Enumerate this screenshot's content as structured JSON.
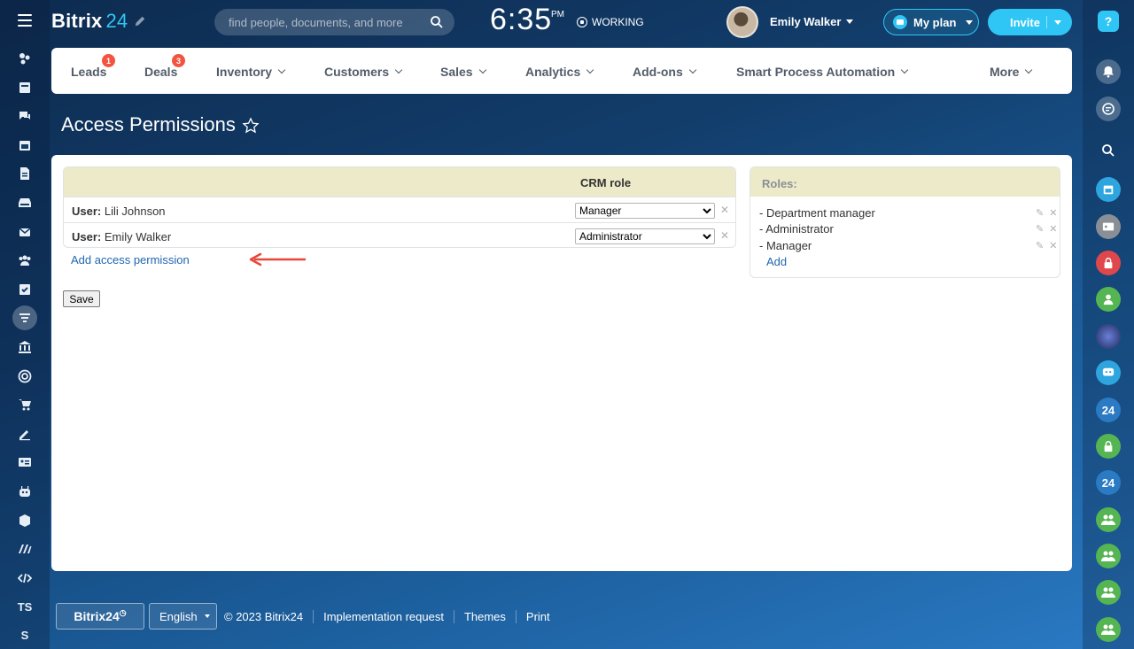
{
  "header": {
    "logo_name": "Bitrix",
    "logo_num": "24",
    "search_placeholder": "find people, documents, and more",
    "clock": "6:35",
    "clock_suffix": "PM",
    "status": "WORKING",
    "user_name": "Emily Walker",
    "myplan_label": "My plan",
    "invite_label": "Invite"
  },
  "left_sidebar": {
    "items": [
      {
        "icon": "feed-icon"
      },
      {
        "icon": "newspaper-icon"
      },
      {
        "icon": "chat-icon"
      },
      {
        "icon": "calendar-icon"
      },
      {
        "icon": "document-icon"
      },
      {
        "icon": "drive-icon"
      },
      {
        "icon": "mail-icon"
      },
      {
        "icon": "team-icon"
      },
      {
        "icon": "tasks-icon"
      },
      {
        "icon": "crm-filter-icon"
      },
      {
        "icon": "bank-icon"
      },
      {
        "icon": "target-icon"
      },
      {
        "icon": "cart-icon"
      },
      {
        "icon": "sign-icon"
      },
      {
        "icon": "contact-card-icon"
      },
      {
        "icon": "robot-icon"
      },
      {
        "icon": "box-icon"
      },
      {
        "icon": "marketing-icon"
      },
      {
        "icon": "code-icon"
      }
    ],
    "text_items": [
      "TS",
      "S"
    ]
  },
  "nav": {
    "items": [
      {
        "label": "Leads",
        "badge": "1"
      },
      {
        "label": "Deals",
        "badge": "3"
      },
      {
        "label": "Inventory"
      },
      {
        "label": "Customers"
      },
      {
        "label": "Sales"
      },
      {
        "label": "Analytics"
      },
      {
        "label": "Add-ons"
      },
      {
        "label": "Smart Process Automation"
      },
      {
        "label": "More"
      }
    ]
  },
  "page": {
    "title": "Access Permissions"
  },
  "permissions": {
    "column_header": "CRM role",
    "rows": [
      {
        "prefix": "User:",
        "name": "Lili Johnson",
        "role": "Manager"
      },
      {
        "prefix": "User:",
        "name": "Emily Walker",
        "role": "Administrator"
      }
    ],
    "role_options": [
      "Department manager",
      "Administrator",
      "Manager"
    ],
    "add_link": "Add access permission",
    "save_label": "Save"
  },
  "roles": {
    "header": "Roles:",
    "items": [
      "- Department manager",
      "- Administrator",
      "- Manager"
    ],
    "add_label": "Add"
  },
  "footer": {
    "logo": "Bitrix24",
    "language": "English",
    "links": [
      "© 2023 Bitrix24",
      "Implementation request",
      "Themes",
      "Print"
    ]
  },
  "right_sidebar": {
    "help": "?",
    "badge_24": "24"
  },
  "colors": {
    "accent": "#2fc6f6",
    "link": "#2067b0",
    "badge": "#f2543f",
    "header_bg": "#eceac9",
    "lock_red": "#e0474c",
    "green": "#55b552"
  }
}
